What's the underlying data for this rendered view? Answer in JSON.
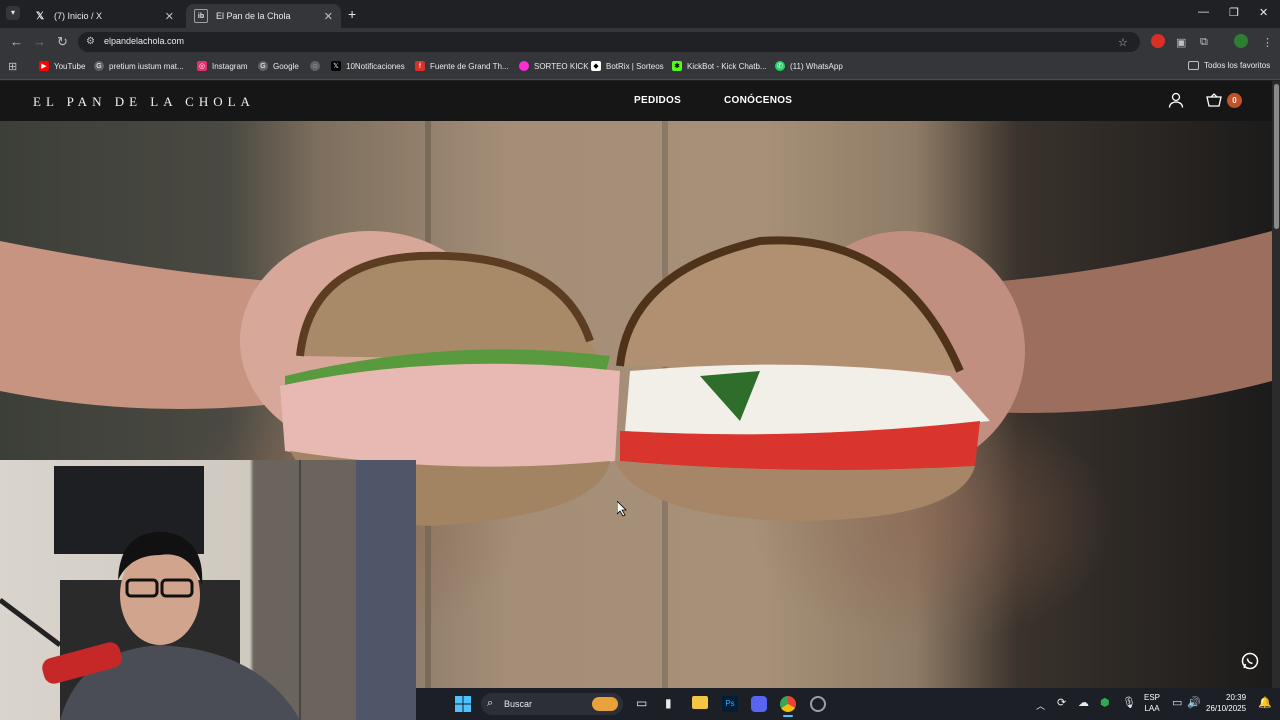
{
  "browser": {
    "tabs": [
      {
        "title": "(7) Inicio / X",
        "icon": "x-icon"
      },
      {
        "title": "El Pan de la Chola",
        "icon": "site-icon"
      }
    ],
    "url": "elpandelachola.com",
    "bookmarks": [
      {
        "label": "YouTube",
        "color": "#ff0000"
      },
      {
        "label": "pretium iustum mat...",
        "color": "#9aa0a6"
      },
      {
        "label": "Instagram",
        "color": "#e1306c"
      },
      {
        "label": "Google",
        "color": "#9aa0a6"
      },
      {
        "label": "",
        "color": "#9aa0a6"
      },
      {
        "label": "10Notificaciones",
        "color": "#000000"
      },
      {
        "label": "Fuente de Grand Th...",
        "color": "#d93025"
      },
      {
        "label": "SORTEO KICK",
        "color": "#ff2bd6"
      },
      {
        "label": "BotRix | Sorteos",
        "color": "#ffffff"
      },
      {
        "label": "KickBot - Kick Chatb...",
        "color": "#53fc18"
      },
      {
        "label": "(11) WhatsApp",
        "color": "#25d366"
      }
    ],
    "all_bookmarks": "Todos los favoritos"
  },
  "site": {
    "logo": "EL PAN DE LA CHOLA",
    "nav": [
      "PEDIDOS",
      "CONÓCENOS"
    ],
    "cart_count": "0"
  },
  "taskbar": {
    "search_placeholder": "Buscar",
    "lang_line1": "ESP",
    "lang_line2": "LAA",
    "time": "20:39",
    "date": "26/10/2025"
  },
  "colors": {
    "browser_bg": "#202124",
    "toolbar_bg": "#35363a",
    "site_header_bg": "#161616",
    "cart_badge": "#c1532b"
  }
}
